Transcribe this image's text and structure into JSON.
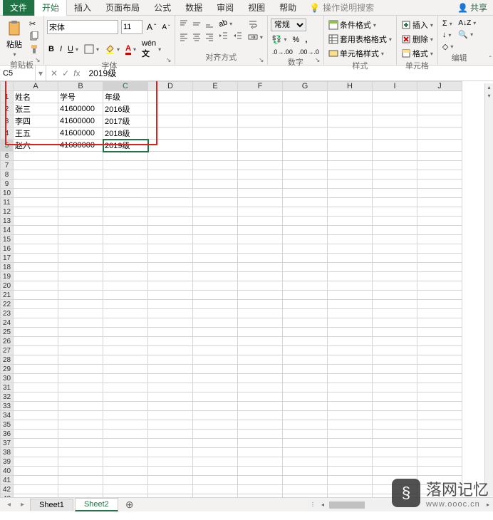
{
  "tabs": {
    "file": "文件",
    "home": "开始",
    "insert": "插入",
    "pageLayout": "页面布局",
    "formulas": "公式",
    "data": "数据",
    "review": "审阅",
    "view": "视图",
    "help": "帮助",
    "tellMe": "操作说明搜索",
    "share": "共享"
  },
  "ribbon": {
    "clipboard": {
      "label": "剪贴板",
      "paste": "粘贴"
    },
    "font": {
      "label": "字体",
      "name": "宋体",
      "size": "11"
    },
    "alignment": {
      "label": "对齐方式"
    },
    "number": {
      "label": "数字",
      "format": "常规",
      "percent": "%"
    },
    "styles": {
      "label": "样式",
      "conditional": "条件格式",
      "table": "套用表格格式",
      "cell": "单元格样式"
    },
    "cells": {
      "label": "单元格",
      "insert": "插入",
      "delete": "删除",
      "format": "格式"
    },
    "editing": {
      "label": "编辑"
    }
  },
  "nameBox": "C5",
  "formulaValue": "2019级",
  "columns": [
    "A",
    "B",
    "C",
    "D",
    "E",
    "F",
    "G",
    "H",
    "I",
    "J"
  ],
  "gridData": {
    "headers": [
      "姓名",
      "学号",
      "年级"
    ],
    "rows": [
      [
        "张三",
        "41600000",
        "2016级"
      ],
      [
        "李四",
        "41600000",
        "2017级"
      ],
      [
        "王五",
        "41600000",
        "2018级"
      ],
      [
        "赵六",
        "41600000",
        "2019级"
      ]
    ]
  },
  "selectedCell": {
    "row": 5,
    "col": "C"
  },
  "rowCount": 43,
  "sheetTabs": {
    "sheet1": "Sheet1",
    "sheet2": "Sheet2",
    "active": "Sheet2"
  },
  "watermark": {
    "text": "落网记忆",
    "sub": "www.oooc.cn"
  }
}
